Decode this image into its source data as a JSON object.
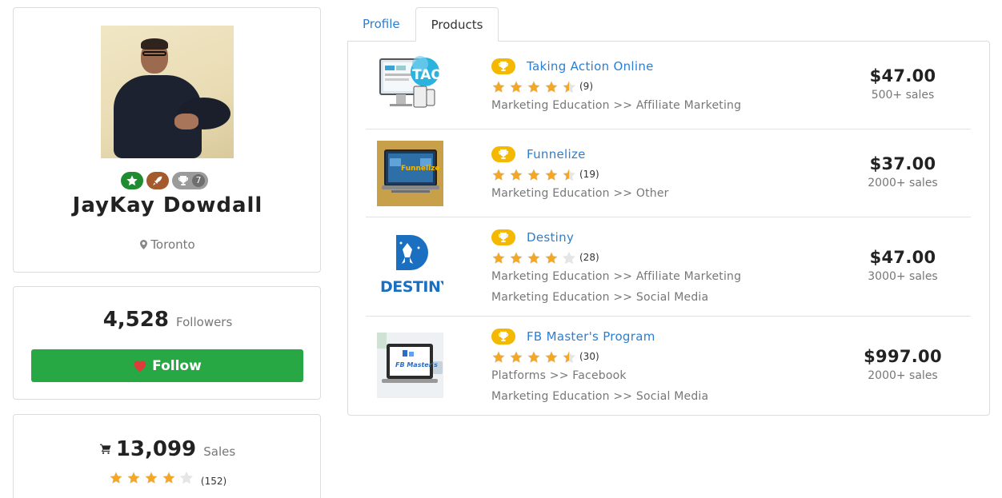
{
  "profile": {
    "name": "JayKay Dowdall",
    "location": "Toronto",
    "badge_count": "7"
  },
  "followers": {
    "count": "4,528",
    "label": "Followers",
    "follow_label": "Follow"
  },
  "sales": {
    "count": "13,099",
    "label": "Sales",
    "rating": 4,
    "rating_count": "(152)"
  },
  "tabs": [
    {
      "label": "Profile",
      "active": false
    },
    {
      "label": "Products",
      "active": true
    }
  ],
  "products": [
    {
      "title": "Taking Action Online",
      "rating": 4.5,
      "rating_count": "(9)",
      "categories": [
        "Marketing Education >> Affiliate Marketing"
      ],
      "price": "$47.00",
      "sales": "500+ sales",
      "thumb_text": "TAO"
    },
    {
      "title": "Funnelize",
      "rating": 4.5,
      "rating_count": "(19)",
      "categories": [
        "Marketing Education >> Other"
      ],
      "price": "$37.00",
      "sales": "2000+ sales",
      "thumb_text": "Funnelize"
    },
    {
      "title": "Destiny",
      "rating": 4,
      "rating_count": "(28)",
      "categories": [
        "Marketing Education >> Affiliate Marketing",
        "Marketing Education >> Social Media"
      ],
      "price": "$47.00",
      "sales": "3000+ sales",
      "thumb_text": "DESTINY"
    },
    {
      "title": "FB Master's Program",
      "rating": 4.5,
      "rating_count": "(30)",
      "categories": [
        "Platforms >> Facebook",
        "Marketing Education >> Social Media"
      ],
      "price": "$997.00",
      "sales": "2000+ sales",
      "thumb_text": "FB Master's"
    }
  ],
  "colors": {
    "link": "#2a7fd4",
    "follow_button": "#28a745",
    "star": "#f5a623",
    "trophy": "#f5b800"
  }
}
